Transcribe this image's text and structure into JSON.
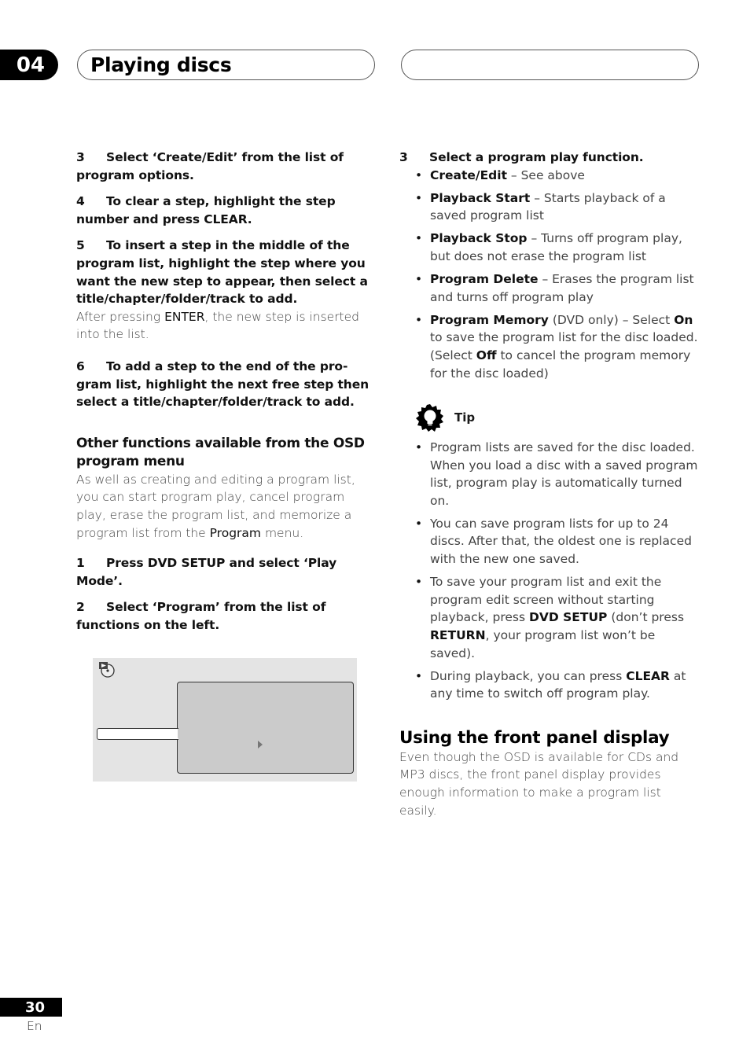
{
  "header": {
    "chapter_number": "04",
    "chapter_title": "Playing discs"
  },
  "left_column": {
    "steps_top": [
      {
        "num": "3",
        "text": "Select ‘Create/Edit’ from the list of program options."
      },
      {
        "num": "4",
        "text": "To clear a step, highlight the step number and press CLEAR."
      },
      {
        "num": "5",
        "text": "To insert a step in the middle of the program list, highlight the step where you want the new step to appear, then select a title/chapter/folder/track to add."
      }
    ],
    "step5_note": {
      "pre": "After pressing ",
      "bold": "ENTER",
      "post": ", the new step is inserted into the list."
    },
    "step6": {
      "num": "6",
      "text": "To add a step to the end of the pro-gram list, highlight the next free step then select a title/chapter/folder/track to add."
    },
    "subheading": "Other functions available from the OSD program menu",
    "intro": {
      "pre": "As well as creating and editing a program list, you can start program play, cancel program play, erase the program list, and memorize a program list from the ",
      "bold": "Program",
      "post": " menu."
    },
    "steps_bottom": [
      {
        "num": "1",
        "text": "Press DVD SETUP and select ‘Play Mode’."
      },
      {
        "num": "2",
        "text": "Select ‘Program’ from the list of functions on the left."
      }
    ],
    "osd_icon": "disc-play-icon",
    "osd_cursor_icon": "right-triangle-icon"
  },
  "right_column": {
    "step3": {
      "num": "3",
      "text": "Select a program play function."
    },
    "functions": [
      {
        "name": "Create/Edit",
        "desc": " – See above"
      },
      {
        "name": "Playback Start",
        "desc": " – Starts playback of a saved program list"
      },
      {
        "name": "Playback Stop",
        "desc": " – Turns off program play, but does not erase the program list"
      },
      {
        "name": "Program Delete",
        "desc": " – Erases the program list and turns off program play"
      }
    ],
    "memory": {
      "name": "Program Memory",
      "p1": " (DVD only) – Select ",
      "on": "On",
      "p2": " to save the program list for the disc loaded. (Select ",
      "off": "Off",
      "p3": " to cancel the program memory for the disc loaded)"
    },
    "tip_label": "Tip",
    "tip_icon": "lightbulb-icon",
    "tips": [
      {
        "text": "Program lists are saved for the disc loaded. When you load a disc with a saved program list, program play is automatically turned on."
      },
      {
        "text": "You can save program lists for up to 24 discs. After that, the oldest one is replaced with the new one saved."
      }
    ],
    "tip3": {
      "p1": "To save your program list and exit the program edit screen without starting playback, press ",
      "b1": "DVD SETUP",
      "p2": " (don’t press ",
      "b2": "RETURN",
      "p3": ", your program list won’t be saved)."
    },
    "tip4": {
      "p1": "During playback, you can press ",
      "b1": "CLEAR",
      "p2": " at any time to switch off program play."
    },
    "section_heading": "Using the front panel display",
    "section_body": "Even though the OSD is available for CDs and MP3 discs, the front panel display provides enough information to make a program list easily."
  },
  "footer": {
    "page_number": "30",
    "language": "En"
  }
}
